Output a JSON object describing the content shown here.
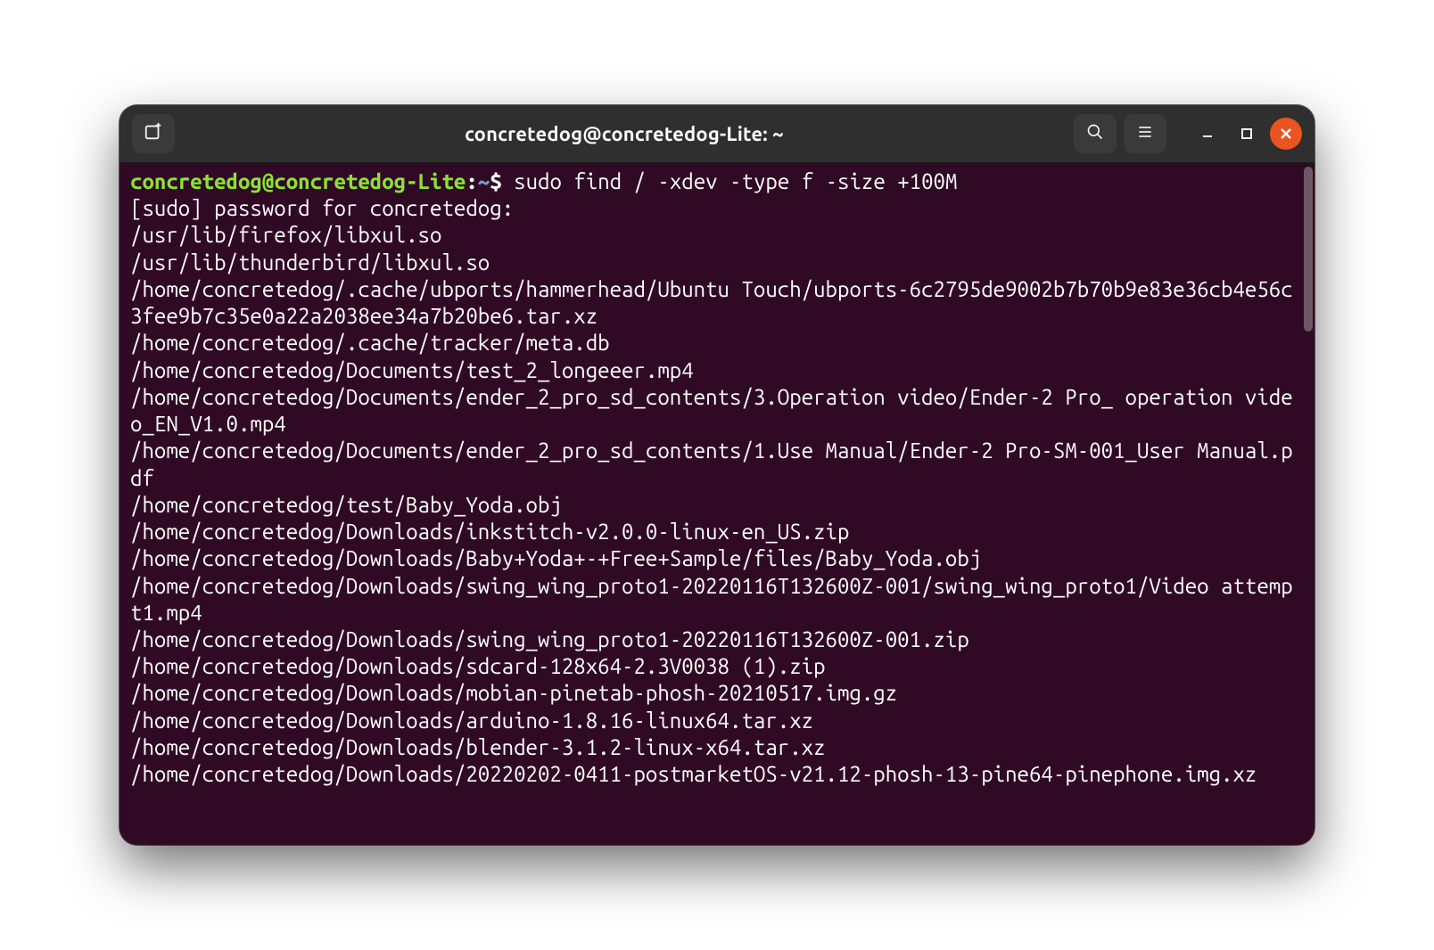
{
  "window": {
    "title": "concretedog@concretedog-Lite: ~"
  },
  "titlebar_icons": {
    "new_tab": "new-tab-icon",
    "search": "search-icon",
    "menu": "hamburger-icon",
    "minimize": "minimize-icon",
    "maximize": "maximize-icon",
    "close": "close-icon"
  },
  "prompt": {
    "user_host": "concretedog@concretedog-Lite",
    "sep1": ":",
    "path": "~",
    "sep2": "$",
    "command": "sudo find / -xdev -type f -size +100M"
  },
  "output_lines": [
    "[sudo] password for concretedog:",
    "/usr/lib/firefox/libxul.so",
    "/usr/lib/thunderbird/libxul.so",
    "/home/concretedog/.cache/ubports/hammerhead/Ubuntu Touch/ubports-6c2795de9002b7b70b9e83e36cb4e56c3fee9b7c35e0a22a2038ee34a7b20be6.tar.xz",
    "/home/concretedog/.cache/tracker/meta.db",
    "/home/concretedog/Documents/test_2_longeeer.mp4",
    "/home/concretedog/Documents/ender_2_pro_sd_contents/3.Operation video/Ender-2 Pro_ operation video_EN_V1.0.mp4",
    "/home/concretedog/Documents/ender_2_pro_sd_contents/1.Use Manual/Ender-2 Pro-SM-001_User Manual.pdf",
    "/home/concretedog/test/Baby_Yoda.obj",
    "/home/concretedog/Downloads/inkstitch-v2.0.0-linux-en_US.zip",
    "/home/concretedog/Downloads/Baby+Yoda+-+Free+Sample/files/Baby_Yoda.obj",
    "/home/concretedog/Downloads/swing_wing_proto1-20220116T132600Z-001/swing_wing_proto1/Video attempt1.mp4",
    "/home/concretedog/Downloads/swing_wing_proto1-20220116T132600Z-001.zip",
    "/home/concretedog/Downloads/sdcard-128x64-2.3V0038 (1).zip",
    "/home/concretedog/Downloads/mobian-pinetab-phosh-20210517.img.gz",
    "/home/concretedog/Downloads/arduino-1.8.16-linux64.tar.xz",
    "/home/concretedog/Downloads/blender-3.1.2-linux-x64.tar.xz",
    "/home/concretedog/Downloads/20220202-0411-postmarketOS-v21.12-phosh-13-pine64-pinephone.img.xz"
  ],
  "colors": {
    "terminal_bg": "#300a24",
    "prompt_green": "#8ae234",
    "prompt_blue": "#729fcf",
    "close_orange": "#e95420"
  }
}
